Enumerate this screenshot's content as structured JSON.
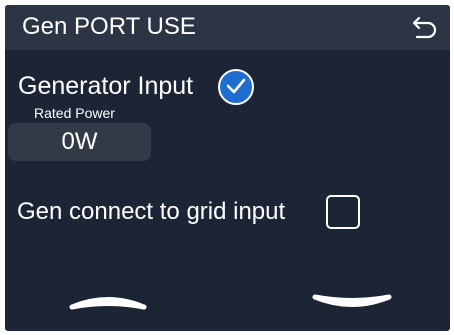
{
  "header": {
    "title": "Gen PORT USE",
    "back_icon": "back-arrow-icon"
  },
  "generator_input": {
    "label": "Generator Input",
    "checked": true,
    "rated_power_label": "Rated Power",
    "rated_power_value": "0W"
  },
  "gen_connect_grid": {
    "label": "Gen connect to grid input",
    "checked": false
  },
  "navigation": {
    "up_icon": "chevron-up-icon",
    "down_icon": "chevron-down-icon"
  },
  "colors": {
    "background": "#1c2535",
    "header_background": "#2c3545",
    "accent": "#1f6dd1",
    "input_background": "#323a48",
    "text": "#ffffff"
  }
}
